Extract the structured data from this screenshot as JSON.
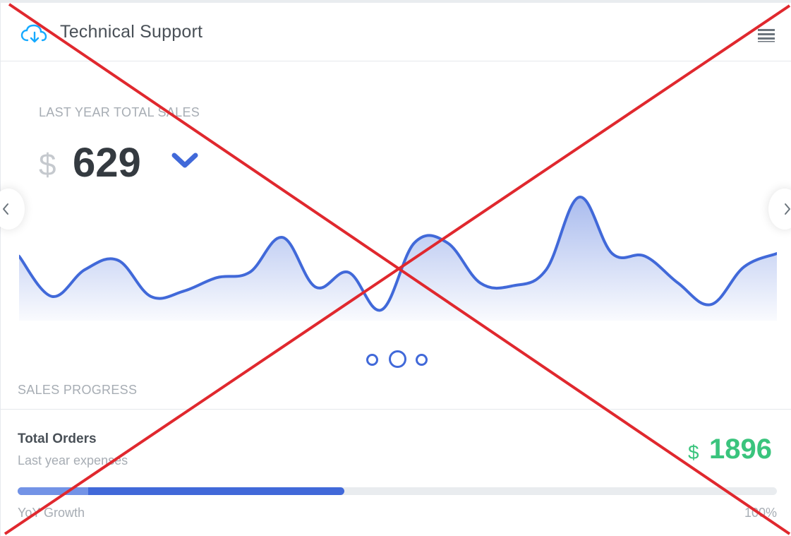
{
  "header": {
    "title": "Technical Support",
    "icon": "cloud-download-icon",
    "menu_icon": "hamburger-menu-icon"
  },
  "sales": {
    "label": "LAST YEAR TOTAL SALES",
    "currency": "$",
    "value": "629",
    "trend_icon": "chevron-down-icon"
  },
  "chart_data": {
    "type": "area",
    "values": [
      48,
      18,
      38,
      45,
      18,
      22,
      32,
      36,
      62,
      25,
      36,
      8,
      58,
      58,
      28,
      26,
      38,
      92,
      50,
      48,
      28,
      12,
      40,
      50
    ],
    "ylim": [
      0,
      100
    ],
    "color": "#4169d9"
  },
  "carousel": {
    "slides": 3,
    "active_index": 1
  },
  "progress": {
    "section_label": "SALES PROGRESS",
    "title": "Total Orders",
    "subtitle": "Last year expenses",
    "currency": "$",
    "value": "1896",
    "growth_label": "YoY Growth",
    "growth_value": "100%",
    "fill_fraction": 0.43
  },
  "colors": {
    "accent": "#4169d9",
    "success": "#3ac47d",
    "muted": "#a7adb4",
    "heading": "#495057",
    "cross": "#e0282e"
  }
}
